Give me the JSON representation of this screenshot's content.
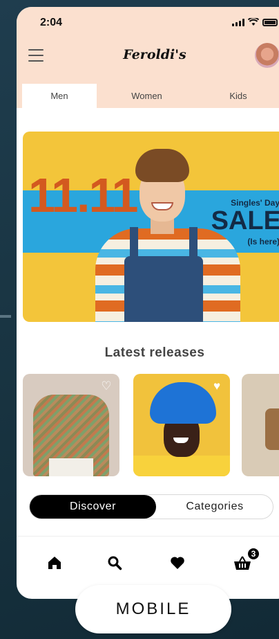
{
  "status": {
    "time": "2:04",
    "icons": [
      "signal-icon",
      "wifi-icon",
      "battery-icon"
    ]
  },
  "header": {
    "logo": "Feroldi's",
    "menu_icon": "hamburger-icon",
    "avatar": "user-avatar"
  },
  "tabs": [
    {
      "label": "Men",
      "active": true
    },
    {
      "label": "Women",
      "active": false
    },
    {
      "label": "Kids",
      "active": false
    }
  ],
  "banner": {
    "date": "11.11",
    "tagline": "Singles' Day",
    "headline": "SALE",
    "sub": "(Is here)"
  },
  "latest": {
    "title": "Latest releases",
    "cards": [
      {
        "name": "knit-sweater-product",
        "favorite": false
      },
      {
        "name": "bucket-hat-product",
        "favorite": true
      },
      {
        "name": "backpack-product",
        "favorite": false
      }
    ]
  },
  "segmented": {
    "discover": "Discover",
    "categories": "Categories",
    "active": "Discover"
  },
  "nav": {
    "items": [
      "home-icon",
      "search-icon",
      "heart-icon",
      "basket-icon"
    ],
    "cart_count": "3"
  },
  "caption": "MOBILE",
  "colors": {
    "header_bg": "#fbe0cf",
    "banner_yellow": "#f3c53a",
    "banner_blue": "#2aa6dd",
    "sale_orange": "#d3591f",
    "sale_navy": "#132b46",
    "page_bg": "#1f3d4e"
  }
}
